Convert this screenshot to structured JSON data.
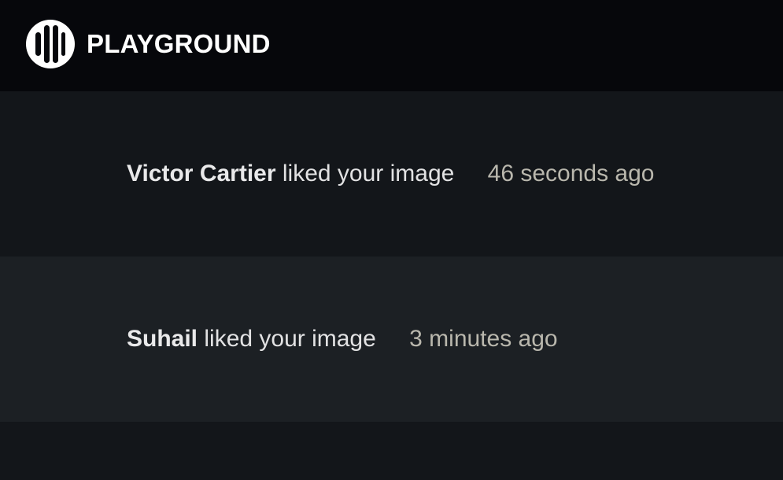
{
  "header": {
    "brand": "PLAYGROUND",
    "logo_icon": "playground-logo-icon",
    "logo_color": "#ffffff",
    "background": "#06070b"
  },
  "notifications": [
    {
      "actor": "Victor Cartier",
      "action": "liked your image",
      "time": "46 seconds ago"
    },
    {
      "actor": "Suhail",
      "action": "liked your image",
      "time": "3 minutes ago"
    }
  ],
  "colors": {
    "page_background": "#13161a",
    "alt_row_background": "#1c2024",
    "timestamp": "#b9b7ad"
  }
}
